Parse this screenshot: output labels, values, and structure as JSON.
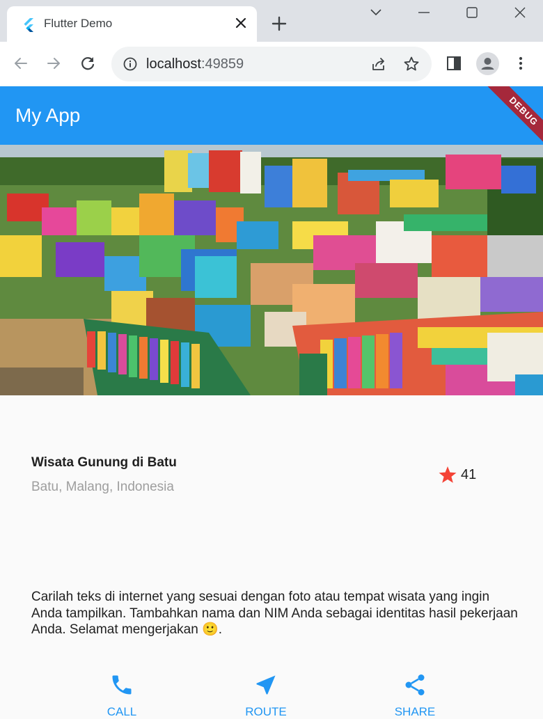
{
  "browser": {
    "tab_title": "Flutter Demo",
    "url_host": "localhost",
    "url_port": ":49859"
  },
  "app": {
    "title": "My App",
    "debug_banner": "DEBUG"
  },
  "place": {
    "name": "Wisata Gunung di Batu",
    "location": "Batu, Malang, Indonesia",
    "rating": "41",
    "description": "Carilah teks di internet yang sesuai dengan foto atau tempat wisata yang ingin Anda tampilkan. Tambahkan nama dan NIM Anda sebagai identitas hasil pekerjaan Anda. Selamat mengerjakan 🙂."
  },
  "actions": [
    {
      "label": "CALL",
      "icon": "phone-icon"
    },
    {
      "label": "ROUTE",
      "icon": "near-me-icon"
    },
    {
      "label": "SHARE",
      "icon": "share-icon"
    }
  ],
  "colors": {
    "primary": "#2196f3",
    "star": "#f44336",
    "debug": "#a5283b"
  }
}
